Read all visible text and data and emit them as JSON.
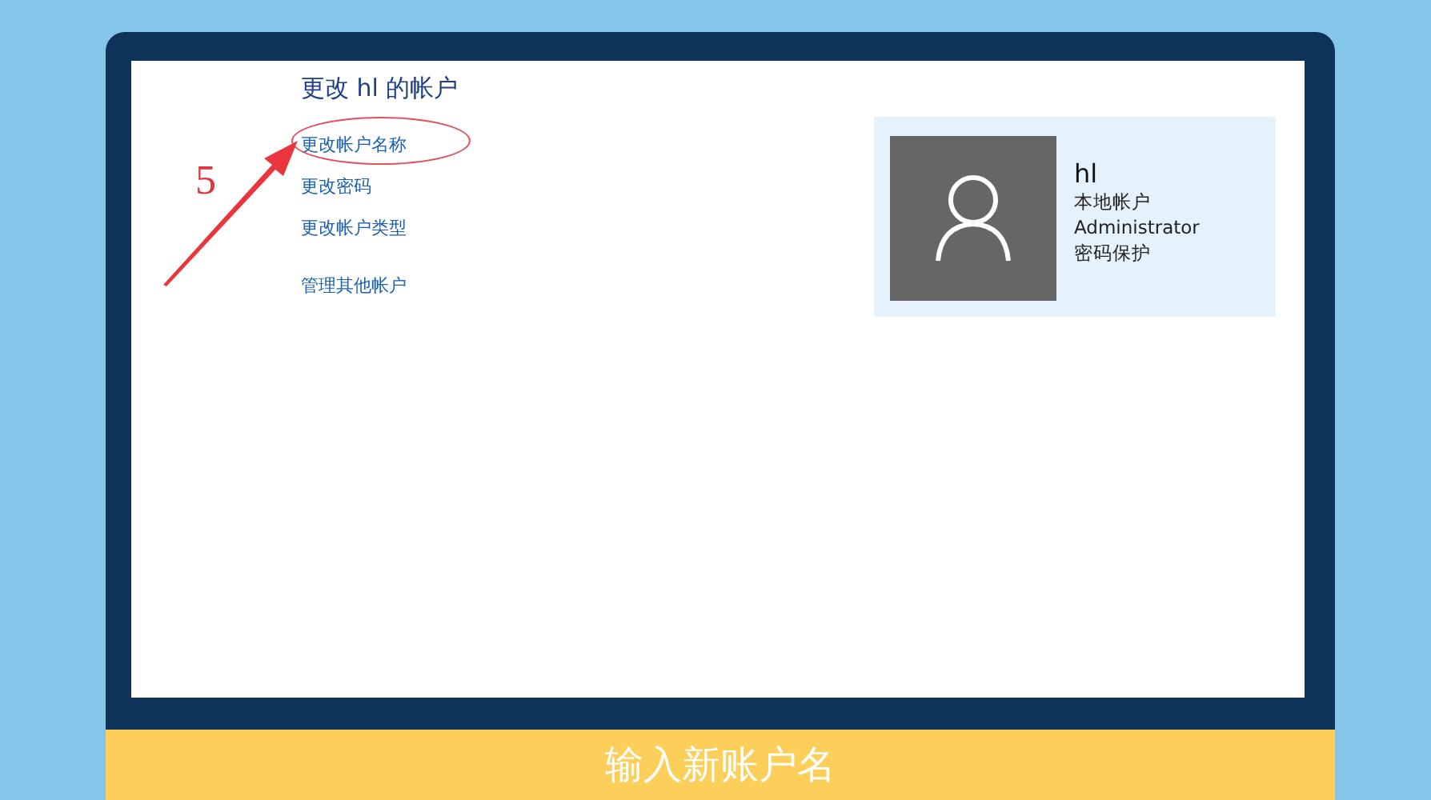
{
  "annotation": {
    "step": "5"
  },
  "panel": {
    "title": "更改 hl 的帐户",
    "links": [
      {
        "label": "更改帐户名称",
        "circled": true
      },
      {
        "label": "更改密码",
        "circled": false
      },
      {
        "label": "更改帐户类型",
        "circled": false
      },
      {
        "label": "管理其他帐户",
        "circled": false
      }
    ]
  },
  "account": {
    "name": "hl",
    "lines": [
      "本地帐户",
      "Administrator",
      "密码保护"
    ]
  },
  "subtitle": "输入新账户名"
}
